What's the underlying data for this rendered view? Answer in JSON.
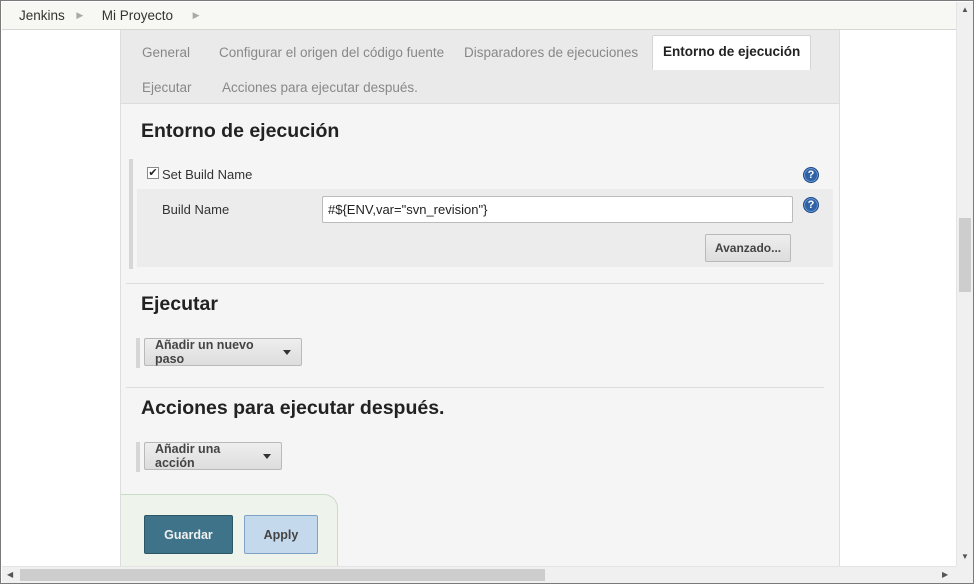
{
  "breadcrumb": {
    "items": [
      "Jenkins",
      "Mi Proyecto"
    ]
  },
  "tabs": {
    "general": "General",
    "scm": "Configurar el origen del código fuente",
    "triggers": "Disparadores de ejecuciones",
    "environment": "Entorno de ejecución",
    "build": "Ejecutar",
    "post_build": "Acciones para ejecutar después."
  },
  "environment": {
    "title": "Entorno de ejecución",
    "set_build_name_label": "Set Build Name",
    "set_build_name_checked": true,
    "build_name_label": "Build Name",
    "build_name_value": "#${ENV,var=\"svn_revision\"}",
    "advanced_button": "Avanzado..."
  },
  "build": {
    "title": "Ejecutar",
    "add_step_button": "Añadir un nuevo paso"
  },
  "post_build": {
    "title": "Acciones para ejecutar después.",
    "add_action_button": "Añadir una acción"
  },
  "actions": {
    "save": "Guardar",
    "apply": "Apply"
  },
  "icons": {
    "help": "help-icon",
    "breadcrumb_separator": "chevron-right-icon",
    "dropdown": "caret-down-icon"
  },
  "colors": {
    "save_button": "#3e7389",
    "apply_button": "#c5d9ec",
    "help_icon": "#2f63a6"
  }
}
